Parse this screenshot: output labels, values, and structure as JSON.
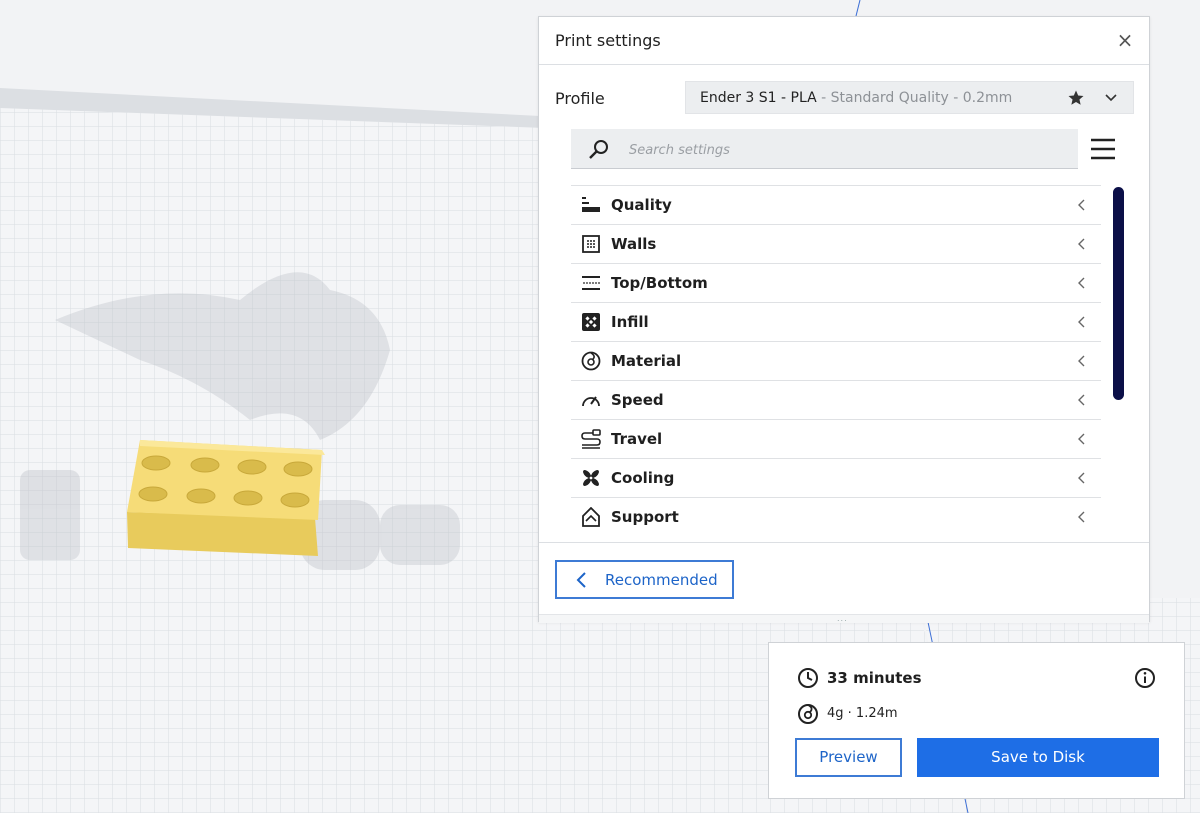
{
  "print_settings": {
    "title": "Print settings",
    "close_glyph": "×",
    "profile_label": "Profile",
    "profile_value_main": "Ender 3 S1 - PLA",
    "profile_value_sub": " - Standard Quality - 0.2mm",
    "search_placeholder": "Search settings",
    "categories": [
      {
        "label": "Quality",
        "icon": "quality-icon"
      },
      {
        "label": "Walls",
        "icon": "walls-icon"
      },
      {
        "label": "Top/Bottom",
        "icon": "top-bottom-icon"
      },
      {
        "label": "Infill",
        "icon": "infill-icon"
      },
      {
        "label": "Material",
        "icon": "material-icon"
      },
      {
        "label": "Speed",
        "icon": "speed-icon"
      },
      {
        "label": "Travel",
        "icon": "travel-icon"
      },
      {
        "label": "Cooling",
        "icon": "cooling-icon"
      },
      {
        "label": "Support",
        "icon": "support-icon"
      }
    ],
    "recommended_label": "Recommended",
    "resize_dots": "..."
  },
  "action_panel": {
    "time": "33 minutes",
    "material": "4g · 1.24m",
    "preview_label": "Preview",
    "save_label": "Save to Disk"
  },
  "colors": {
    "accent_blue": "#1e6ee6",
    "scrollbar_navy": "#0b0f48",
    "model_yellow": "#f6dc78"
  }
}
